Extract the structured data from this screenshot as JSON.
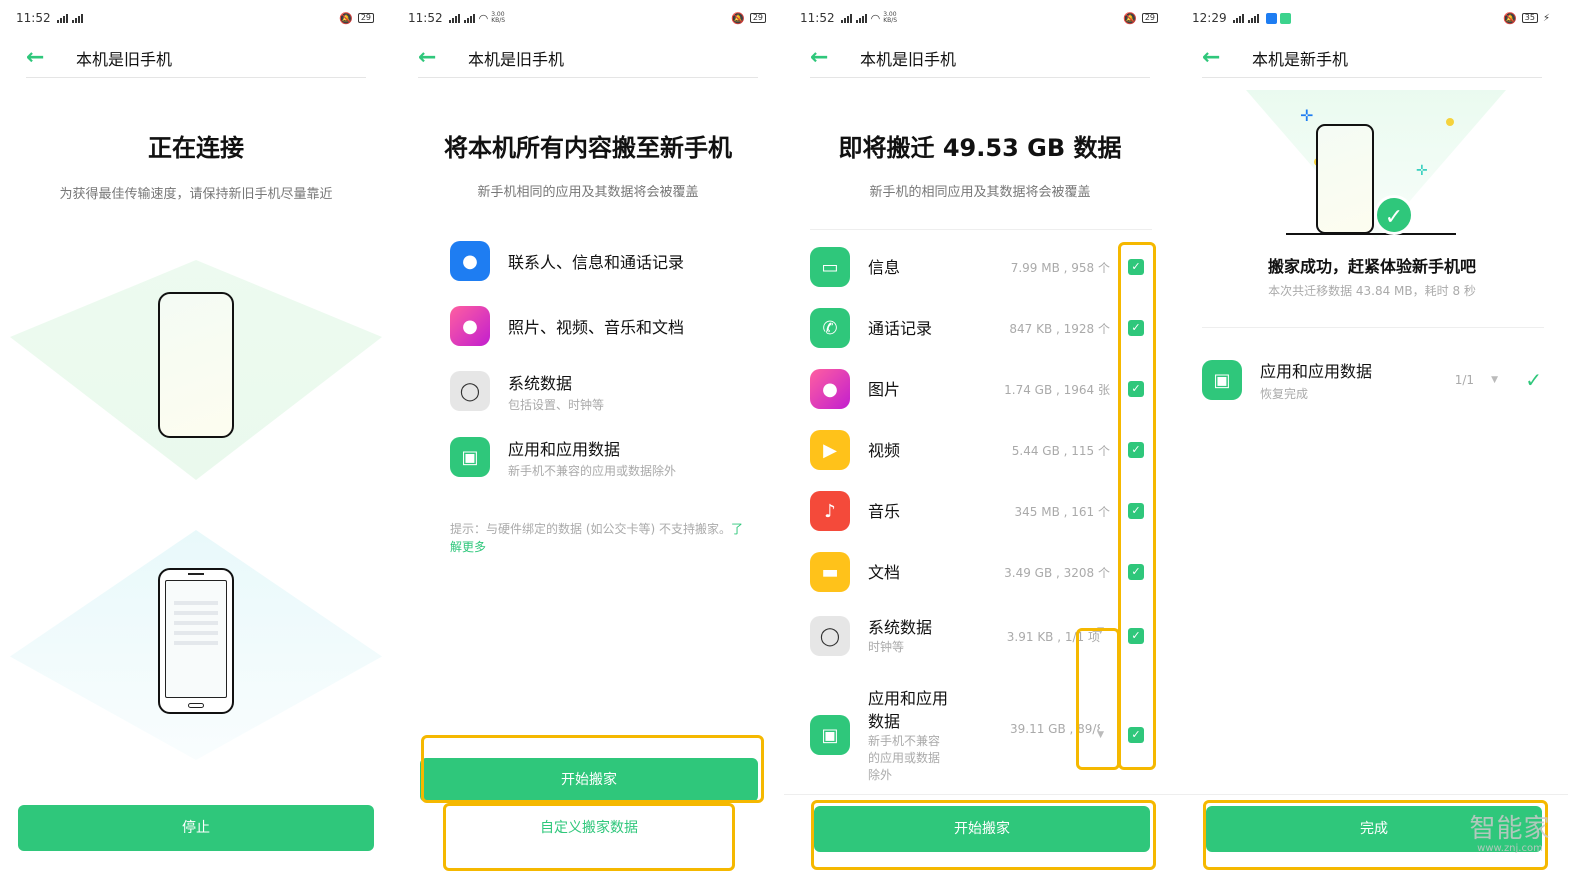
{
  "screens": [
    {
      "status": {
        "time": "11:52",
        "speed": "",
        "battery": "29"
      },
      "header": {
        "title": "本机是旧手机"
      },
      "title": "正在连接",
      "subtitle": "为获得最佳传输速度，请保持新旧手机尽量靠近",
      "button": "停止"
    },
    {
      "status": {
        "time": "11:52",
        "speed": "3.00 KB/S",
        "battery": "29"
      },
      "header": {
        "title": "本机是旧手机"
      },
      "title": "将本机所有内容搬至新手机",
      "subtitle": "新手机相同的应用及其数据将会被覆盖",
      "options": [
        {
          "label": "联系人、信息和通话记录",
          "desc": "",
          "icon": "contact-icon",
          "color": "#1e7df2"
        },
        {
          "label": "照片、视频、音乐和文档",
          "desc": "",
          "icon": "gallery-icon",
          "color": "#f0367a"
        },
        {
          "label": "系统数据",
          "desc": "包括设置、时钟等",
          "icon": "settings-icon",
          "color": "#d9d9d9"
        },
        {
          "label": "应用和应用数据",
          "desc": "新手机不兼容的应用或数据除外",
          "icon": "android-icon",
          "color": "#2fc77b"
        }
      ],
      "tip": "提示：与硬件绑定的数据 (如公交卡等) 不支持搬家。",
      "tip_link": "了解更多",
      "button": "开始搬家",
      "link_button": "自定义搬家数据"
    },
    {
      "status": {
        "time": "11:52",
        "speed": "3.00 KB/S",
        "battery": "29"
      },
      "header": {
        "title": "本机是旧手机"
      },
      "title": "即将搬迁 49.53 GB 数据",
      "subtitle": "新手机的相同应用及其数据将会被覆盖",
      "items": [
        {
          "label": "信息",
          "desc": "",
          "size": "7.99 MB , 958 个",
          "icon": "message-icon",
          "color": "#2fc77b",
          "expandable": false
        },
        {
          "label": "通话记录",
          "desc": "",
          "size": "847 KB , 1928 个",
          "icon": "phone-icon",
          "color": "#2fc77b",
          "expandable": false
        },
        {
          "label": "图片",
          "desc": "",
          "size": "1.74 GB , 1964 张",
          "icon": "gallery-icon",
          "color": "#f0367a",
          "expandable": false
        },
        {
          "label": "视频",
          "desc": "",
          "size": "5.44 GB , 115 个",
          "icon": "video-icon",
          "color": "#ffc21a",
          "expandable": false
        },
        {
          "label": "音乐",
          "desc": "",
          "size": "345 MB , 161 个",
          "icon": "music-icon",
          "color": "#f44a3a",
          "expandable": false
        },
        {
          "label": "文档",
          "desc": "",
          "size": "3.49 GB , 3208 个",
          "icon": "document-icon",
          "color": "#ffc21a",
          "expandable": false
        },
        {
          "label": "系统数据",
          "desc": "时钟等",
          "size": "3.91 KB , 1/1 项",
          "icon": "settings-icon",
          "color": "#d9d9d9",
          "expandable": true
        },
        {
          "label": "应用和应用数据",
          "desc": "新手机不兼容的应用或数据除外",
          "size": "39.11 GB , 89/89 个",
          "icon": "android-icon",
          "color": "#2fc77b",
          "expandable": true
        }
      ],
      "button": "开始搬家"
    },
    {
      "status": {
        "time": "12:29",
        "speed": "",
        "battery": "35"
      },
      "header": {
        "title": "本机是新手机"
      },
      "title": "搬家成功，赶紧体验新手机吧",
      "subtitle": "本次共迁移数据 43.84 MB，耗时 8 秒",
      "item": {
        "label": "应用和应用数据",
        "desc": "恢复完成",
        "count": "1/1",
        "icon": "android-icon",
        "color": "#2fc77b"
      },
      "button": "完成"
    }
  ],
  "watermark": {
    "text": "智能家",
    "url": "www.znj.com"
  },
  "accent": "#2fc77b",
  "highlight": "#f5b800"
}
